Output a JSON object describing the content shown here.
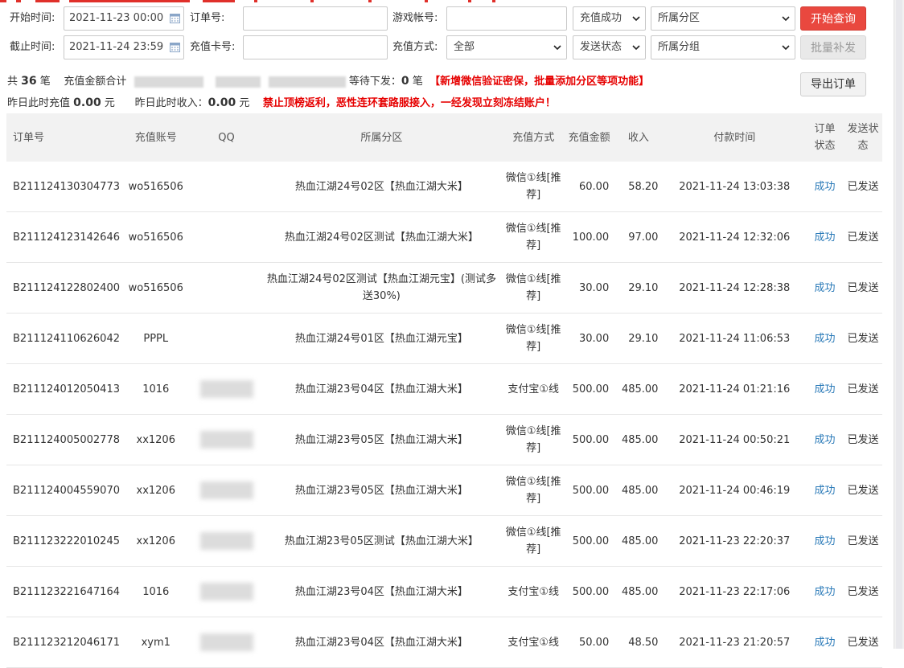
{
  "filters": {
    "start_time_label": "开始时间:",
    "start_time_value": "2021-11-23 00:00",
    "end_time_label": "截止时间:",
    "end_time_value": "2021-11-24 23:59",
    "order_no_label": "订单号:",
    "order_no_value": "",
    "card_no_label": "充值卡号:",
    "card_no_value": "",
    "game_account_label": "游戏帐号:",
    "game_account_value": "",
    "pay_method_label": "充值方式:",
    "pay_method_value": "全部",
    "recharge_status_value": "充值成功",
    "send_status_value": "发送状态",
    "zone_value": "所属分区",
    "group_value": "所属分组",
    "search_button": "开始查询",
    "batch_button": "批量补发",
    "export_button": "导出订单"
  },
  "summary": {
    "total_prefix": "共",
    "total_count": "36",
    "total_unit": "笔",
    "amount_label": "充值金额合计",
    "pending_label": "等待下发：",
    "pending_count": "0",
    "pending_unit": "笔",
    "notice1": "【新增微信验证密保，批量添加分区等项功能】",
    "yesterday_recharge_label": "昨日此时充值",
    "yesterday_recharge_value": "0.00",
    "yesterday_recharge_unit": "元",
    "yesterday_income_label": "昨日此时收入：",
    "yesterday_income_value": "0.00",
    "yesterday_income_unit": "元",
    "notice2": "禁止顶榜返利，恶性连环套路服接入，一经发现立刻冻结账户！"
  },
  "table": {
    "headers": [
      "订单号",
      "充值账号",
      "QQ",
      "所属分区",
      "充值方式",
      "充值金额",
      "收入",
      "付款时间",
      "订单状态",
      "发送状态"
    ],
    "rows": [
      {
        "order": "B211124130304773",
        "account": "wo516506",
        "qq": "",
        "zone": "热血江湖24号02区【热血江湖大米】",
        "method": "微信①线[推荐]",
        "amount": "60.00",
        "income": "58.20",
        "time": "2021-11-24 13:03:38",
        "status": "成功",
        "send": "已发送"
      },
      {
        "order": "B211124123142646",
        "account": "wo516506",
        "qq": "",
        "zone": "热血江湖24号02区测试【热血江湖大米】",
        "method": "微信①线[推荐]",
        "amount": "100.00",
        "income": "97.00",
        "time": "2021-11-24 12:32:06",
        "status": "成功",
        "send": "已发送"
      },
      {
        "order": "B211124122802400",
        "account": "wo516506",
        "qq": "",
        "zone": "热血江湖24号02区测试【热血江湖元宝】(测试多送30%)",
        "method": "微信①线[推荐]",
        "amount": "30.00",
        "income": "29.10",
        "time": "2021-11-24 12:28:38",
        "status": "成功",
        "send": "已发送"
      },
      {
        "order": "B211124110626042",
        "account": "PPPL",
        "qq": "",
        "zone": "热血江湖24号01区【热血江湖元宝】",
        "method": "微信①线[推荐]",
        "amount": "30.00",
        "income": "29.10",
        "time": "2021-11-24 11:06:53",
        "status": "成功",
        "send": "已发送"
      },
      {
        "order": "B211124012050413",
        "account": "1016",
        "qq": "blurred",
        "zone": "热血江湖23号04区【热血江湖大米】",
        "method": "支付宝①线",
        "amount": "500.00",
        "income": "485.00",
        "time": "2021-11-24 01:21:16",
        "status": "成功",
        "send": "已发送"
      },
      {
        "order": "B211124005002778",
        "account": "xx1206",
        "qq": "blurred",
        "zone": "热血江湖23号05区【热血江湖大米】",
        "method": "微信①线[推荐]",
        "amount": "500.00",
        "income": "485.00",
        "time": "2021-11-24 00:50:21",
        "status": "成功",
        "send": "已发送"
      },
      {
        "order": "B211124004559070",
        "account": "xx1206",
        "qq": "blurred",
        "zone": "热血江湖23号05区【热血江湖大米】",
        "method": "微信①线[推荐]",
        "amount": "500.00",
        "income": "485.00",
        "time": "2021-11-24 00:46:19",
        "status": "成功",
        "send": "已发送"
      },
      {
        "order": "B211123222010245",
        "account": "xx1206",
        "qq": "blurred",
        "zone": "热血江湖23号05区测试【热血江湖大米】",
        "method": "微信①线[推荐]",
        "amount": "500.00",
        "income": "485.00",
        "time": "2021-11-23 22:20:37",
        "status": "成功",
        "send": "已发送"
      },
      {
        "order": "B211123221647164",
        "account": "1016",
        "qq": "blurred",
        "zone": "热血江湖23号04区【热血江湖大米】",
        "method": "支付宝①线",
        "amount": "500.00",
        "income": "485.00",
        "time": "2021-11-23 22:17:06",
        "status": "成功",
        "send": "已发送"
      },
      {
        "order": "B211123212046171",
        "account": "xym1",
        "qq": "blurred",
        "zone": "热血江湖23号04区【热血江湖大米】",
        "method": "支付宝①线",
        "amount": "50.00",
        "income": "48.50",
        "time": "2021-11-23 21:20:57",
        "status": "成功",
        "send": "已发送"
      }
    ]
  },
  "colors": {
    "primary": "#e9483f",
    "notice_red": "#e60000",
    "link_blue": "#2a7ab8",
    "header_bg": "#f2f2f2"
  },
  "icons": {
    "calendar": "calendar-icon",
    "dropdown": "chevron-down-icon"
  }
}
